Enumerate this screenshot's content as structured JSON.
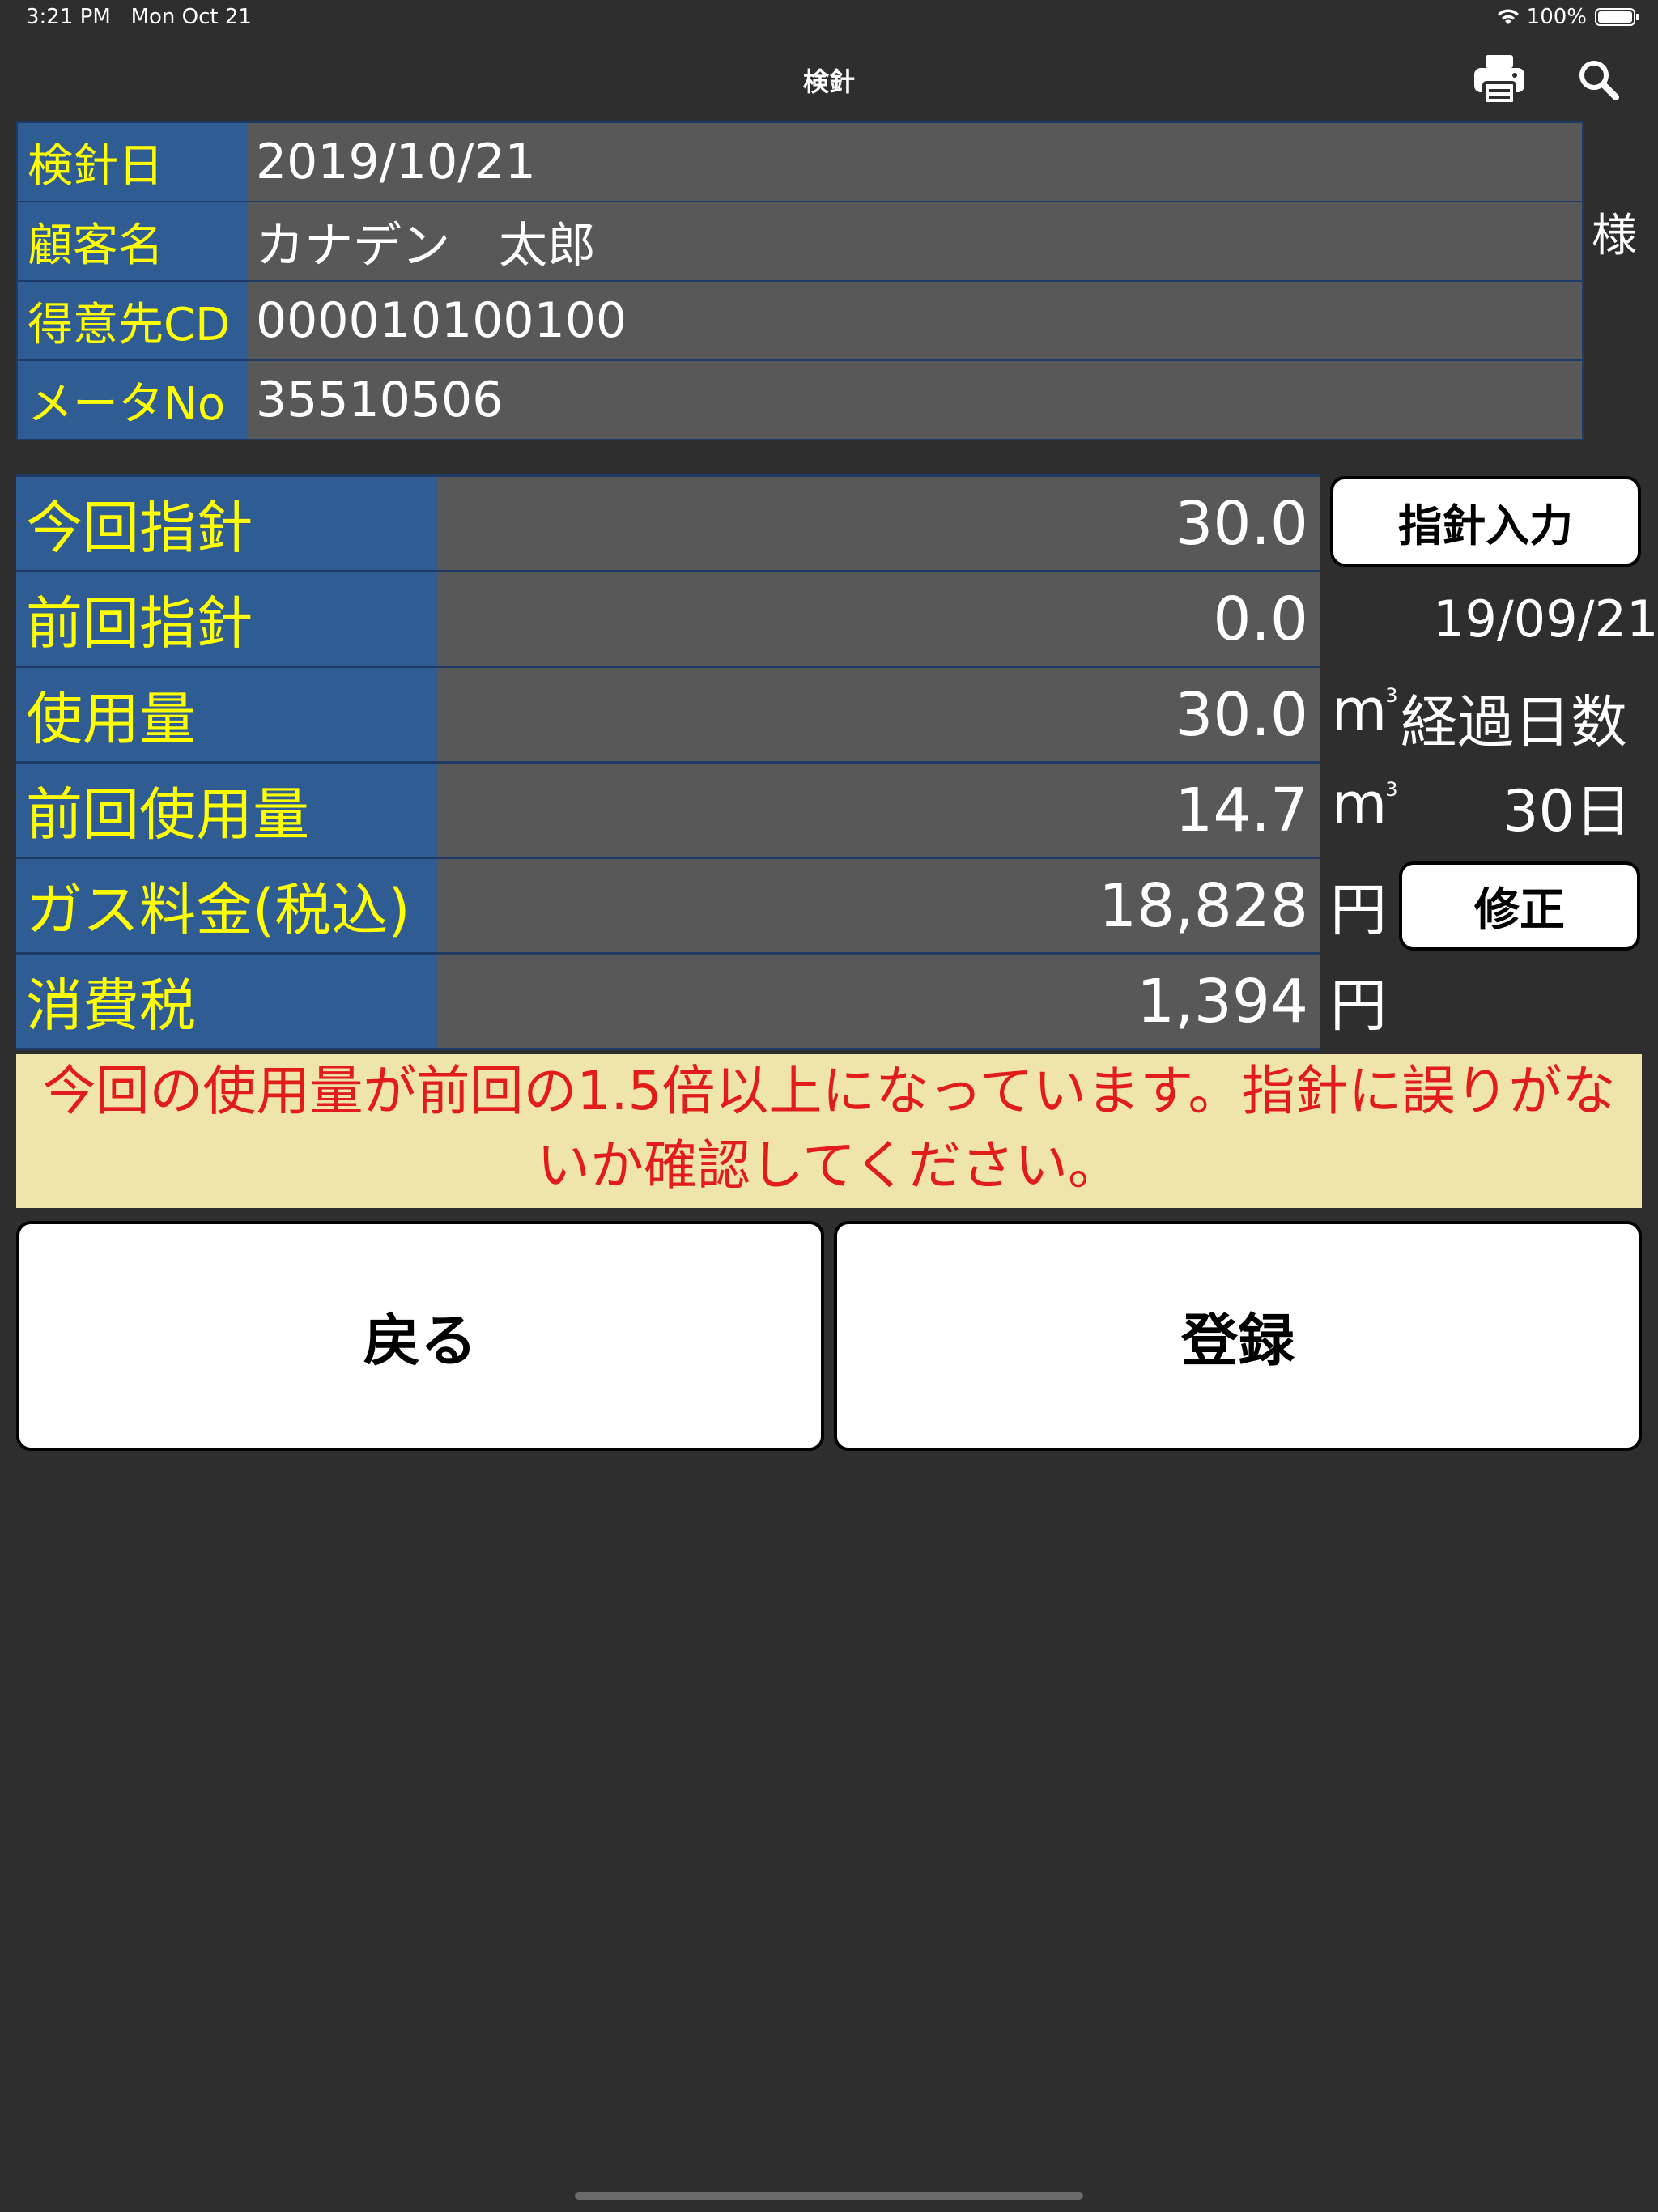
{
  "status_bar": {
    "time": "3:21 PM",
    "date": "Mon Oct 21",
    "battery": "100%"
  },
  "nav": {
    "title": "検針",
    "print_icon": "printer-icon",
    "search_icon": "search-icon"
  },
  "customer_info": {
    "rows": [
      {
        "label": "検針日",
        "value": "2019/10/21"
      },
      {
        "label": "顧客名",
        "value": "カナデン　太郎"
      },
      {
        "label": "得意先CD",
        "value": "000010100100"
      },
      {
        "label": "メータNo",
        "value": "35510506"
      }
    ],
    "honorific": "様"
  },
  "readings": {
    "rows": [
      {
        "label": "今回指針",
        "value": "30.0"
      },
      {
        "label": "前回指針",
        "value": "0.0"
      },
      {
        "label": "使用量",
        "value": "30.0"
      },
      {
        "label": "前回使用量",
        "value": "14.7"
      },
      {
        "label": "ガス料金(税込)",
        "value": "18,828"
      },
      {
        "label": "消費税",
        "value": "1,394"
      }
    ],
    "input_button": "指針入力",
    "previous_date": "19/09/21",
    "unit_m": "m",
    "unit_sup": "3",
    "yen": "円",
    "elapsed_label": "経過日数",
    "elapsed_value": "30日",
    "fix_button": "修正"
  },
  "warning": "今回の使用量が前回の1.5倍以上になっています。指針に誤りがないか確認してください。",
  "actions": {
    "back": "戻る",
    "register": "登録"
  }
}
